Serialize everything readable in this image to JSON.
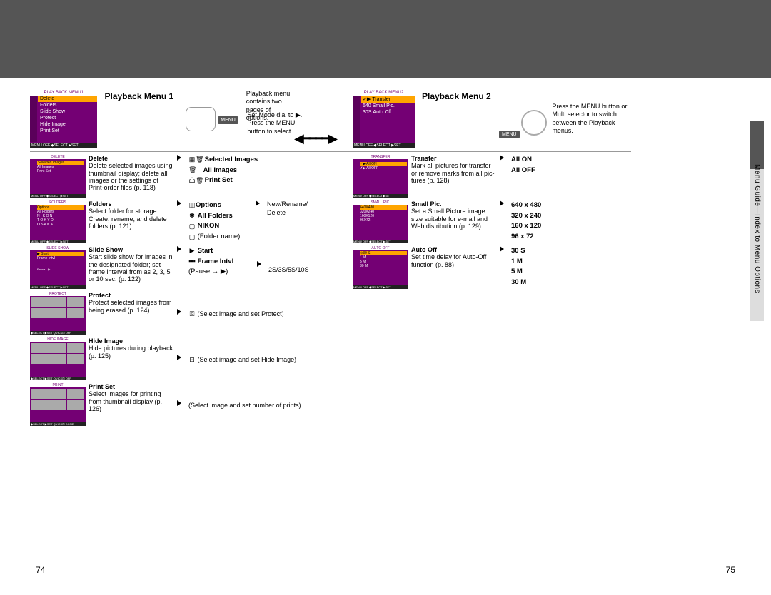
{
  "page_left": "74",
  "page_right": "75",
  "side_label": "Menu Guide—Index to Menu Options",
  "menu1": {
    "title": "Playback Menu 1",
    "lcd_title": "PLAY BACK MENU1",
    "lcd_items": [
      "Delete",
      "Folders",
      "Slide Show",
      "Protect",
      "Hide Image",
      "Print Set"
    ],
    "lcd_foot": "MENU OFF   ◆SELECT  ▶SET",
    "instr1": "Set Mode dial to ▶.",
    "instr2": "Press the MENU button to select.",
    "note": "Playback menu contains two pages of options.",
    "menu_label": "MENU"
  },
  "menu2": {
    "title": "Playback Menu 2",
    "lcd_title": "PLAY BACK MENU2",
    "lcd_items_a": [
      "Transfer",
      "Small Pic.",
      "Auto Off"
    ],
    "lcd_prefix": [
      "✓▶",
      "640",
      "30S"
    ],
    "lcd_foot": "MENU OFF   ◆SELECT  ▶SET",
    "instr": "Press the MENU button or Multi selector to switch between the Playback menus.",
    "menu_label": "MENU"
  },
  "delete": {
    "lcd_t": "DELETE",
    "h": "Delete",
    "d": "Delete selected images using thumbnail display; delete all images or the settings of Print-order files (p. 118)",
    "opts": [
      "Selected Images",
      "All Images",
      "Print Set"
    ]
  },
  "folders": {
    "lcd_t": "FOLDERS",
    "lcd_rows": [
      "Options",
      "All Folders",
      "N I K O N",
      "T O K Y O",
      "O S A K A"
    ],
    "h": "Folders",
    "d": "Select folder for storage. Create, rename, and delete folders (p. 121)",
    "opts": [
      "Options",
      "All Folders",
      "NIKON"
    ],
    "foldername": "(Folder name)",
    "sub": [
      "New/Rename/",
      "Delete"
    ]
  },
  "slide": {
    "lcd_t": "SLIDE SHOW",
    "lcd_rows": [
      "Start",
      "Frame Intvl"
    ],
    "h": "Slide Show",
    "d": "Start slide show for images in the designated folder; set frame interval from as 2, 3, 5 or 10 sec. (p. 122)",
    "opts": [
      "Start",
      "Frame Intvl"
    ],
    "pause": "(Pause → ▶)",
    "sub": "2S/3S/5S/10S"
  },
  "protect": {
    "lcd_t": "PROTECT",
    "h": "Protect",
    "d": "Protect selected images from being erased (p. 124)",
    "note": "(Select image and set Protect)"
  },
  "hide": {
    "lcd_t": "HIDE IMAGE",
    "h": "Hide Image",
    "d": "Hide pictures during playback (p. 125)",
    "note": "(Select image and set Hide Image)"
  },
  "print": {
    "lcd_t": "PRINT",
    "h": "Print Set",
    "d": "Select images for printing from thumbnail display (p. 126)",
    "note": "(Select image and set number of prints)"
  },
  "transfer": {
    "lcd_t": "TRANSFER",
    "h": "Transfer",
    "d": "Mark all pictures for transfer or remove marks from all pic-tures (p. 128)",
    "opts": [
      "All ON",
      "All OFF"
    ]
  },
  "small": {
    "lcd_t": "SMALL PIC.",
    "lcd_rows": [
      "640X480",
      "320X240",
      "160X120",
      "96X72"
    ],
    "h": "Small Pic.",
    "d": "Set a Small Picture image size suitable for e-mail and Web distribution (p. 129)",
    "opts": [
      "640 x 480",
      "320 x 240",
      "160 x 120",
      "96 x 72"
    ]
  },
  "auto": {
    "lcd_t": "AUTO OFF",
    "lcd_rows": [
      "30 S",
      "1 M",
      "5 M",
      "30 M"
    ],
    "h": "Auto Off",
    "d": "Set time delay for Auto-Off function (p. 88)",
    "opts": [
      "30 S",
      "1 M",
      "5 M",
      "30 M"
    ]
  }
}
